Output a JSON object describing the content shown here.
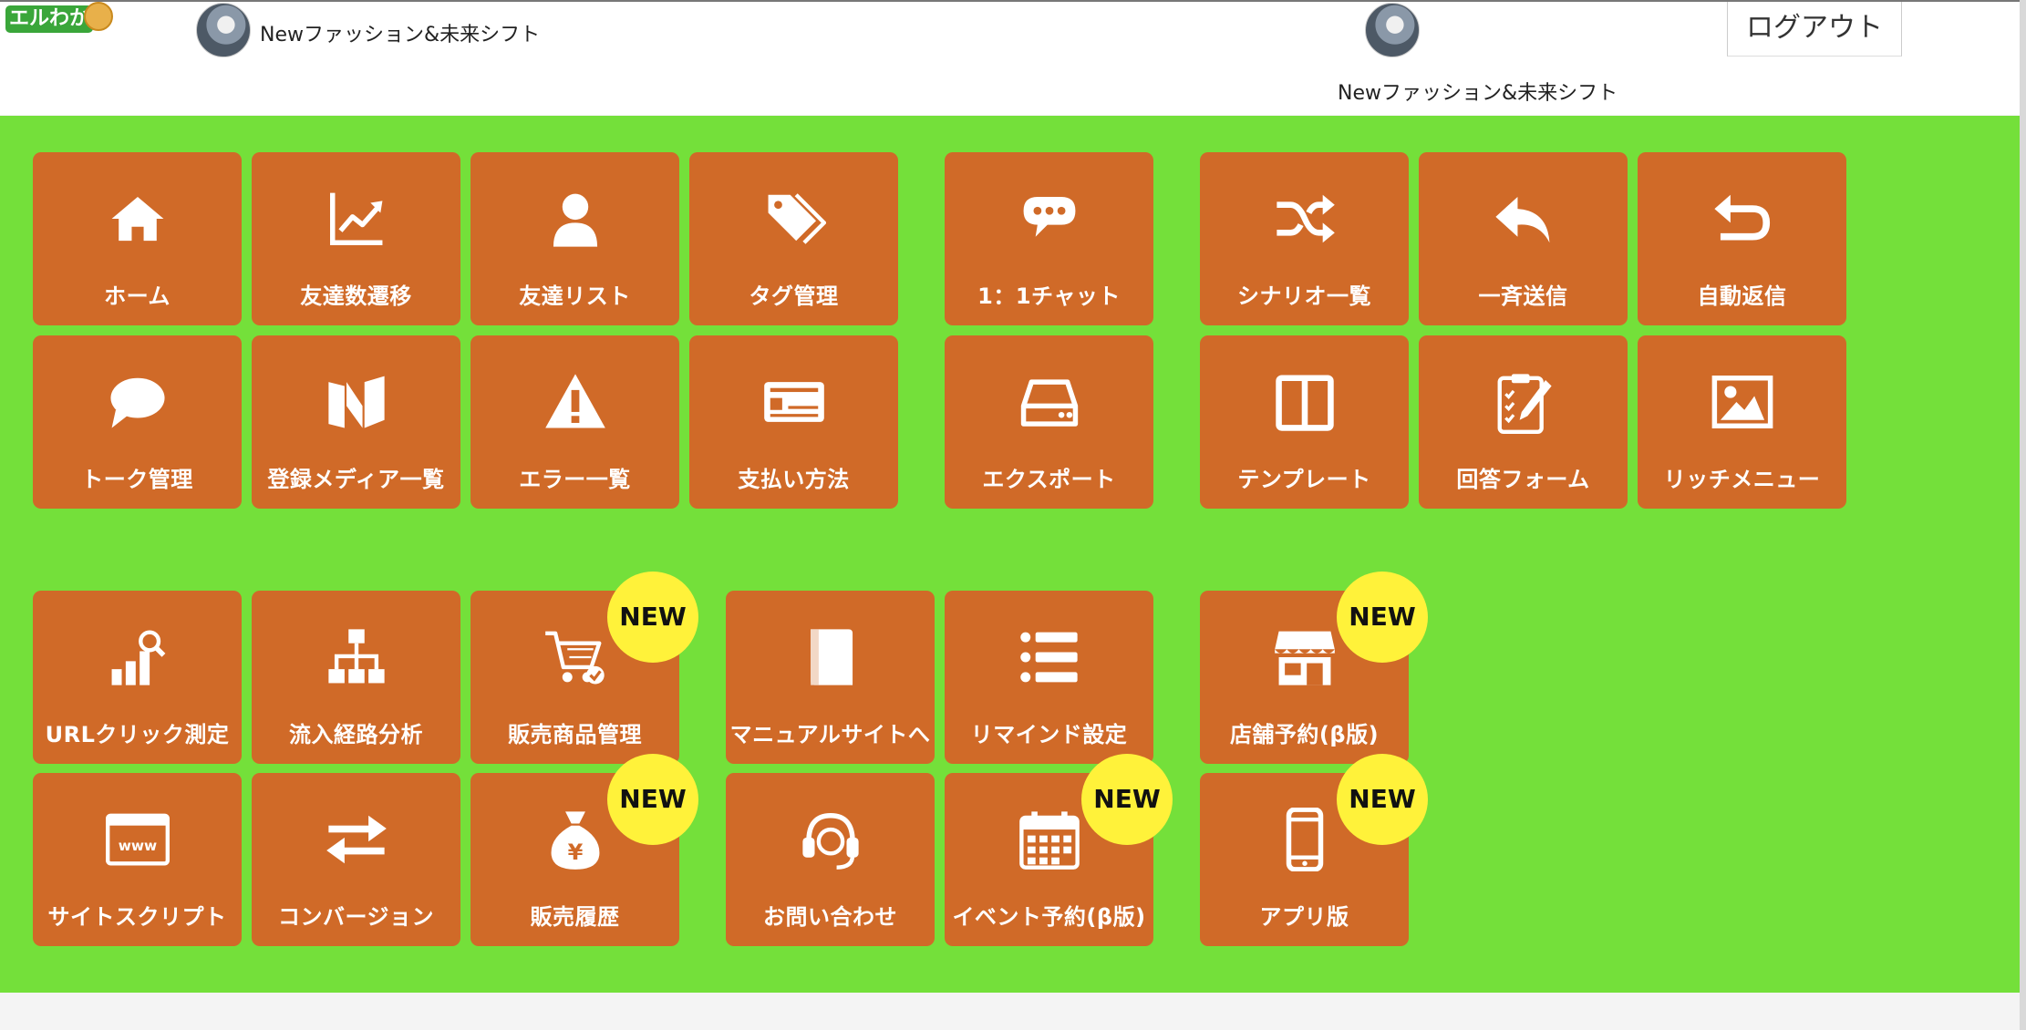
{
  "header": {
    "logo_text": "エルわか",
    "account_name_left": "Newファッション&未来シフト",
    "account_name_right": "Newファッション&未来シフト",
    "logout_label": "ログアウト"
  },
  "colors": {
    "panel": "#74e03a",
    "tile": "#d06a28",
    "badge": "#fff23a"
  },
  "badge_text": "NEW",
  "tiles": [
    {
      "label": "ホーム",
      "icon": "home-icon"
    },
    {
      "label": "友達数遷移",
      "icon": "chart-line-icon"
    },
    {
      "label": "友達リスト",
      "icon": "user-icon"
    },
    {
      "label": "タグ管理",
      "icon": "tags-icon"
    },
    {
      "label": "1：1チャット",
      "icon": "chat-dots-icon"
    },
    {
      "label": "シナリオ一覧",
      "icon": "shuffle-icon"
    },
    {
      "label": "一斉送信",
      "icon": "reply-icon"
    },
    {
      "label": "自動返信",
      "icon": "undo-icon"
    },
    {
      "label": "トーク管理",
      "icon": "speech-bubble-icon"
    },
    {
      "label": "登録メディア一覧",
      "icon": "media-icon"
    },
    {
      "label": "エラー一覧",
      "icon": "warning-icon"
    },
    {
      "label": "支払い方法",
      "icon": "credit-card-icon"
    },
    {
      "label": "エクスポート",
      "icon": "drive-icon"
    },
    {
      "label": "テンプレート",
      "icon": "columns-icon"
    },
    {
      "label": "回答フォーム",
      "icon": "clipboard-icon"
    },
    {
      "label": "リッチメニュー",
      "icon": "image-icon"
    },
    {
      "label": "URLクリック測定",
      "icon": "analytics-icon"
    },
    {
      "label": "流入経路分析",
      "icon": "sitemap-icon"
    },
    {
      "label": "販売商品管理",
      "icon": "cart-icon"
    },
    {
      "label": "マニュアルサイトへ",
      "icon": "book-icon"
    },
    {
      "label": "リマインド設定",
      "icon": "list-icon"
    },
    {
      "label": "店舗予約(β版)",
      "icon": "store-icon"
    },
    {
      "label": "サイトスクリプト",
      "icon": "www-icon"
    },
    {
      "label": "コンバージョン",
      "icon": "exchange-icon"
    },
    {
      "label": "販売履歴",
      "icon": "money-bag-icon"
    },
    {
      "label": "お問い合わせ",
      "icon": "headset-icon"
    },
    {
      "label": "イベント予約(β版)",
      "icon": "calendar-icon"
    },
    {
      "label": "アプリ版",
      "icon": "mobile-icon"
    }
  ]
}
